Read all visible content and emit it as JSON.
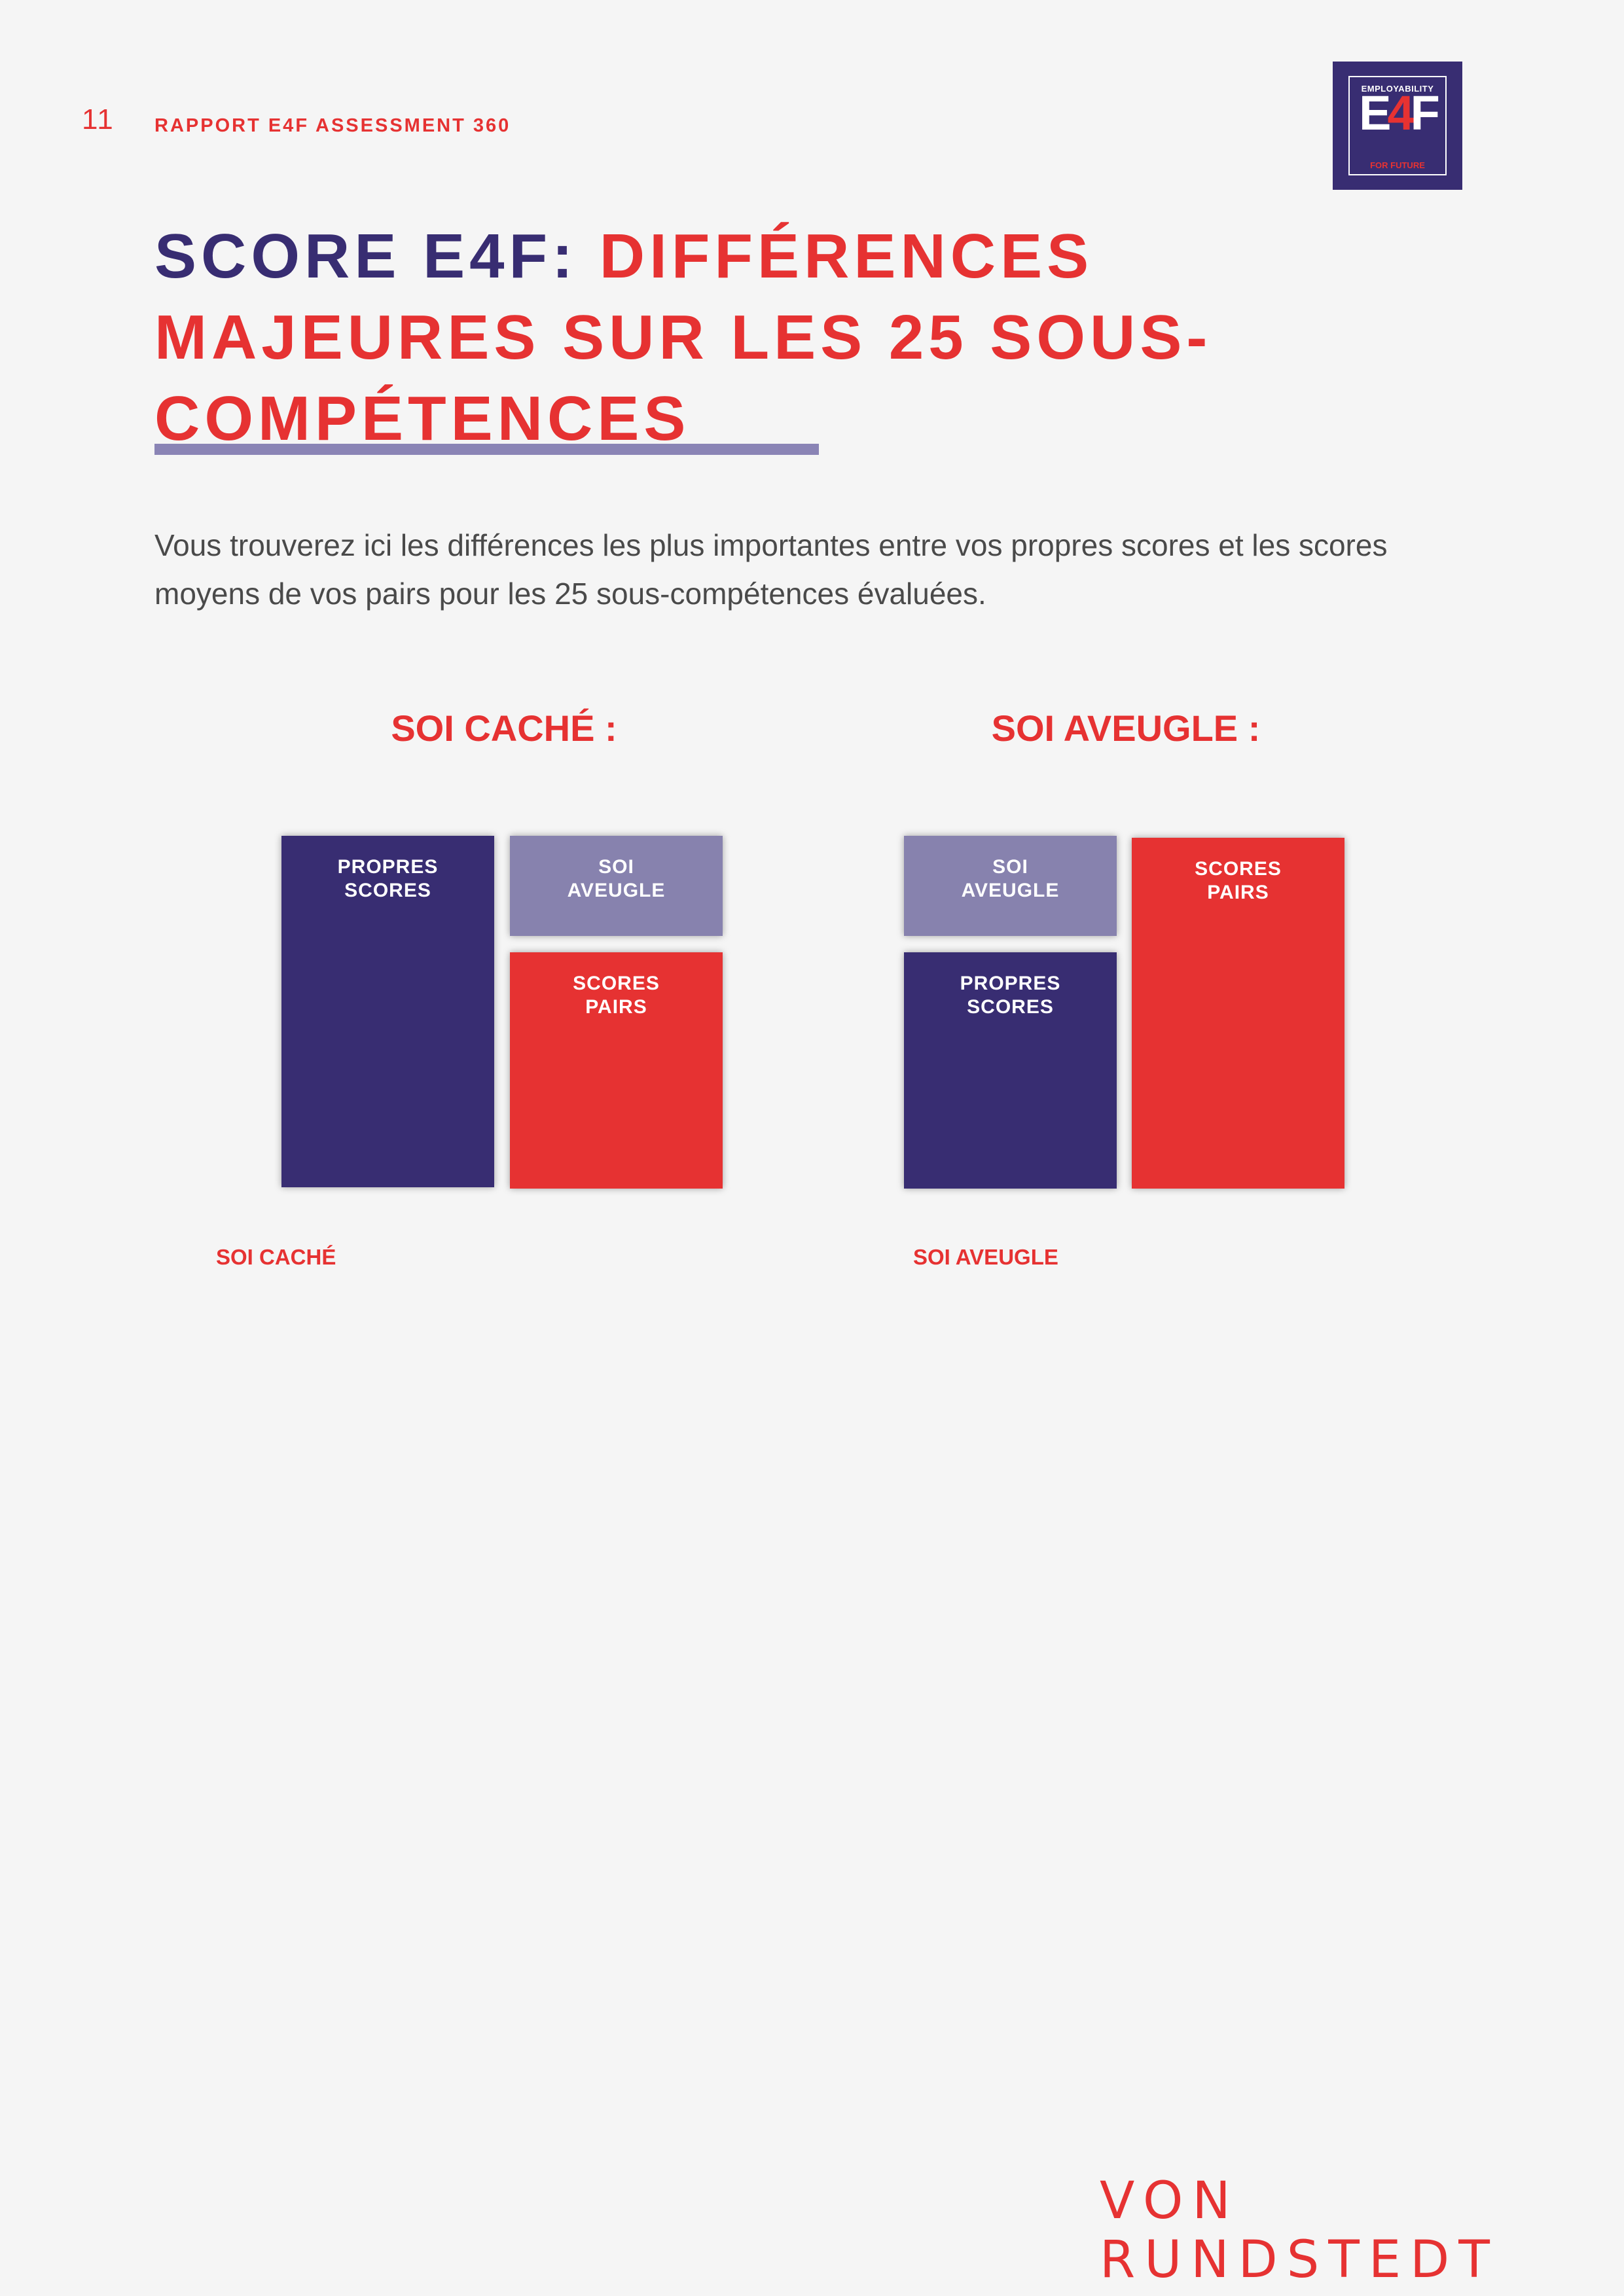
{
  "header": {
    "page_number": "11",
    "report_title": "RAPPORT E4F ASSESSMENT 360"
  },
  "logo": {
    "top_text": "EMPLOYABILITY",
    "mark_e": "E",
    "mark_4": "4",
    "mark_f": "F",
    "bottom_text": "FOR FUTURE"
  },
  "headline": {
    "lead": "SCORE E4F:",
    "rest": "DIFFÉRENCES MAJEURES SUR LES 25 SOUS-COMPÉTENCES"
  },
  "intro": "Vous trouverez ici les différences les plus importantes entre vos propres scores et les scores moyens de vos pairs pour les 25 sous-compétences évaluées.",
  "sections": {
    "hidden_self": {
      "title": "SOI CACHÉ :",
      "caption": "SOI CACHÉ",
      "blocks": {
        "own_scores": [
          "PROPRES",
          "SCORES"
        ],
        "blind_self": [
          "SOI",
          "AVEUGLE"
        ],
        "peer_scores": [
          "SCORES",
          "PAIRS"
        ]
      }
    },
    "blind_self": {
      "title": "SOI AVEUGLE :",
      "caption": "SOI AVEUGLE",
      "blocks": {
        "blind_self": [
          "SOI",
          "AVEUGLE"
        ],
        "own_scores": [
          "PROPRES",
          "SCORES"
        ],
        "peer_scores": [
          "SCORES",
          "PAIRS"
        ]
      }
    }
  },
  "footer": {
    "brand": "VON RUNDSTEDT"
  },
  "colors": {
    "navy": "#382d72",
    "red": "#e63232",
    "lilac": "#8782ae",
    "rule": "#8a84b5",
    "background": "#f5f5f5"
  }
}
